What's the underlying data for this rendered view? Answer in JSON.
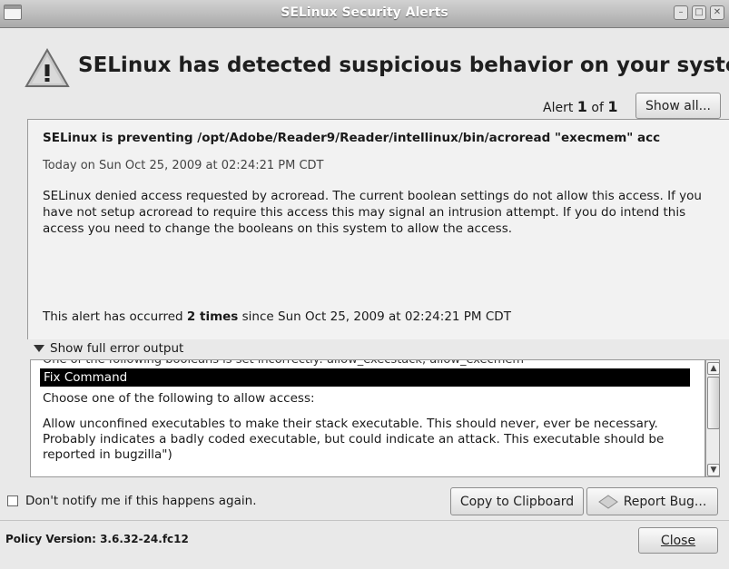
{
  "window": {
    "title": "SELinux Security Alerts",
    "controls": [
      "minimize-icon",
      "maximize-icon",
      "close-window-icon"
    ]
  },
  "header": {
    "title": "SELinux has detected suspicious behavior on your system",
    "icon": "warning-triangle-icon"
  },
  "alert_nav": {
    "label_prefix": "Alert",
    "current": "1",
    "of_label": "of",
    "total": "1",
    "show_all_label": "Show all..."
  },
  "alert": {
    "summary": "SELinux is preventing /opt/Adobe/Reader9/Reader/intellinux/bin/acroread \"execmem\" acc",
    "timestamp": "Today on Sun Oct 25, 2009 at 02:24:21 PM CDT",
    "description": "SELinux denied access requested by acroread. The current boolean settings do not allow this access. If you have not setup acroread to require this access this may signal an intrusion attempt. If you do intend this access you need to change the booleans on this system to allow the access.",
    "occurred_prefix": "This alert has occurred",
    "occurred_count": "2 times",
    "occurred_suffix": "since Sun Oct 25, 2009 at 02:24:21 PM CDT"
  },
  "error_output": {
    "toggle_label": "Show full error output",
    "cut_line": "One of the following booleans is set incorrectly: allow_execstack, allow_execmem",
    "fix_header": "Fix Command",
    "choose_line": "Choose one of the following to allow access:",
    "allow_text": "Allow unconfined executables to make their stack executable. This should never, ever be necessary. Probably indicates a badly coded executable, but could indicate an attack. This executable should be reported in bugzilla\")"
  },
  "footer": {
    "notify_label": "Don't notify me if this happens again.",
    "copy_label": "Copy to Clipboard",
    "report_label": "Report Bug...",
    "policy_label": "Policy Version: 3.6.32-24.fc12",
    "close_label": "Close"
  }
}
